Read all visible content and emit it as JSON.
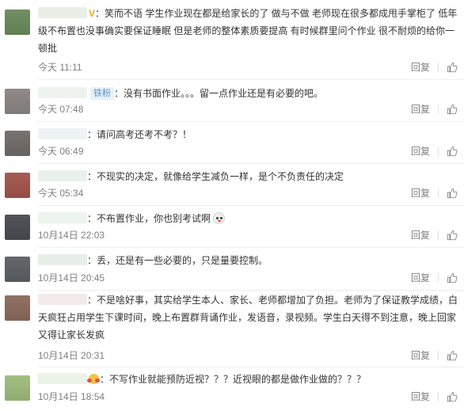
{
  "comments": [
    {
      "badge": "V",
      "text": "：笑而不语 学生作业现在都是给家长的了 做与不做 老师现在很多都成甩手掌柜了 低年级不布置也没事确实要保证睡眠 但是老师的整体素质要提高 有时候群里问个作业 很不耐烦的给你一顿批",
      "time": "今天 11:11",
      "reply": "回复",
      "avatar_color": "#6a8a5a",
      "name_color": "#e9efe6"
    },
    {
      "badge": "铁粉",
      "text": "：没有书面作业。。。留一点作业还是有必要的吧。",
      "time": "今天 07:48",
      "reply": "回复",
      "avatar_color": "#8a8482",
      "name_color": "#eef3ee"
    },
    {
      "text": "：请问高考还考不考？！",
      "time": "今天 06:49",
      "reply": "回复",
      "avatar_color": "#6f6b69",
      "name_color": "#eef2f5"
    },
    {
      "text": "：不现实的决定，就像给学生减负一样，是个不负责任的决定",
      "time": "今天 05:34",
      "reply": "回复",
      "avatar_color": "#a2554a",
      "name_color": "#eaf0ea"
    },
    {
      "text": "：不布置作业，你也别考试啊",
      "time": "10月14日 22:03",
      "reply": "回复",
      "avatar_color": "#4a4a52",
      "name_color": "#eef4ee"
    },
    {
      "text": "：丢，还是有一些必要的，只是量要控制。",
      "time": "10月14日 20:45",
      "reply": "回复",
      "avatar_color": "#5c5f63",
      "name_color": "#e8efe8"
    },
    {
      "text": "：不是啥好事，其实给学生本人、家长、老师都增加了负担。老师为了保证教学成绩，白天疯狂占用学生下课时间，晚上布置群背诵作业，发语音，录视频。学生白天得不到注意，晚上回家又得让家长发疯",
      "time": "10月14日 20:31",
      "reply": "回复",
      "avatar_color": "#8a6a5c",
      "name_color": "#f4eaea"
    },
    {
      "text": "：不写作业就能预防近视？？？近视眼的都是做作业做的？？？",
      "time": "10月14日 18:54",
      "reply": "回复",
      "avatar_color": "#9dbb7a",
      "name_color": "#eaf3e6"
    }
  ]
}
